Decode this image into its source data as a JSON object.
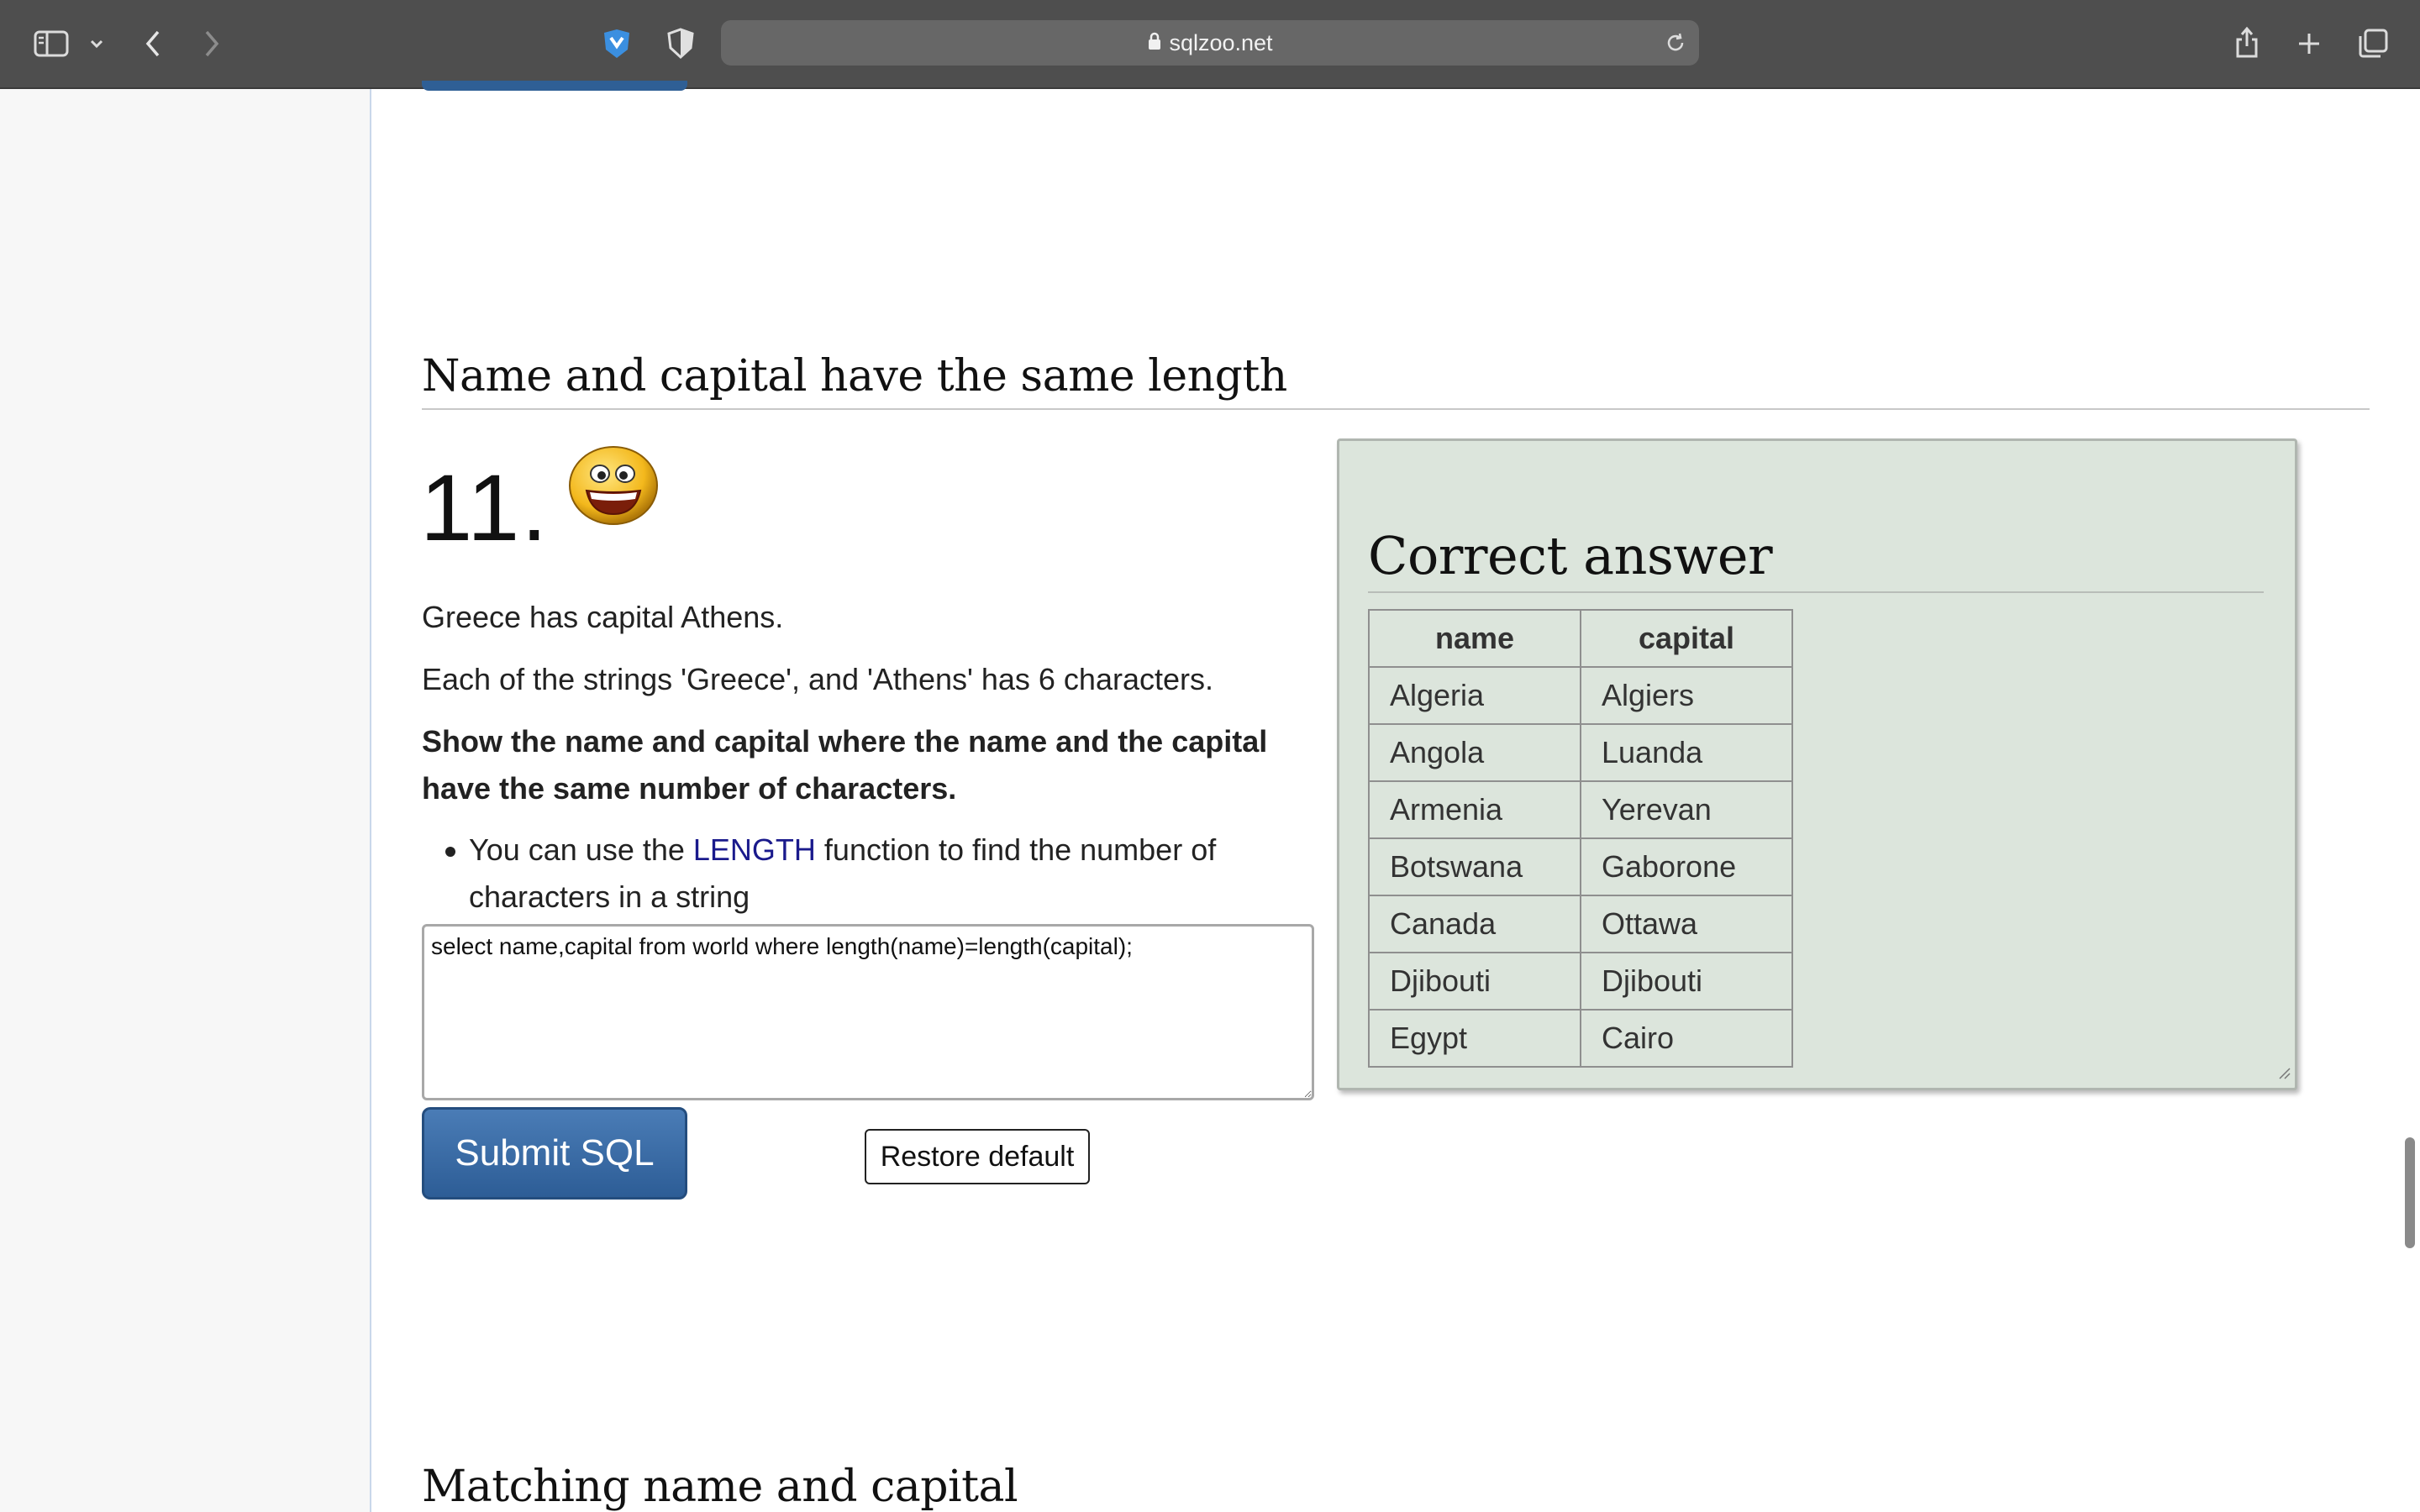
{
  "browser": {
    "url": "sqlzoo.net",
    "icons": {
      "sidebar": "sidebar-icon",
      "sidebar_menu": "chevron-down-icon",
      "back": "back-icon",
      "forward": "forward-icon",
      "extension": "shield-extension-icon",
      "privacy": "privacy-shield-icon",
      "lock": "lock-icon",
      "reload": "reload-icon",
      "share": "share-icon",
      "new_tab": "plus-icon",
      "tabs": "tabs-overview-icon"
    }
  },
  "section": {
    "heading": "Name and capital have the same length",
    "number": "11.",
    "emoji": "smiley-face-icon",
    "p1": "Greece has capital Athens.",
    "p2": "Each of the strings 'Greece', and 'Athens' has 6 characters.",
    "p3_line1": "Show the name and capital where the name and the capital",
    "p3_line2": "have the same number of characters.",
    "hint_prefix": "You can use the ",
    "hint_link": "LENGTH",
    "hint_suffix_line1": " function to find the number of",
    "hint_suffix_line2": "characters in a string",
    "sql": "select name,capital from world where length(name)=length(capital);",
    "submit_label": "Submit SQL",
    "restore_label": "Restore default"
  },
  "answer": {
    "title": "Correct answer",
    "columns": [
      "name",
      "capital"
    ],
    "rows": [
      [
        "Algeria",
        "Algiers"
      ],
      [
        "Angola",
        "Luanda"
      ],
      [
        "Armenia",
        "Yerevan"
      ],
      [
        "Botswana",
        "Gaborone"
      ],
      [
        "Canada",
        "Ottawa"
      ],
      [
        "Djibouti",
        "Djibouti"
      ],
      [
        "Egypt",
        "Cairo"
      ]
    ]
  },
  "next_section": {
    "heading": "Matching name and capital"
  },
  "colors": {
    "toolbar": "#4e4e4e",
    "submit_button": "#2d5d96",
    "answer_panel": "#dce5dc",
    "link": "#1a1a8c"
  }
}
